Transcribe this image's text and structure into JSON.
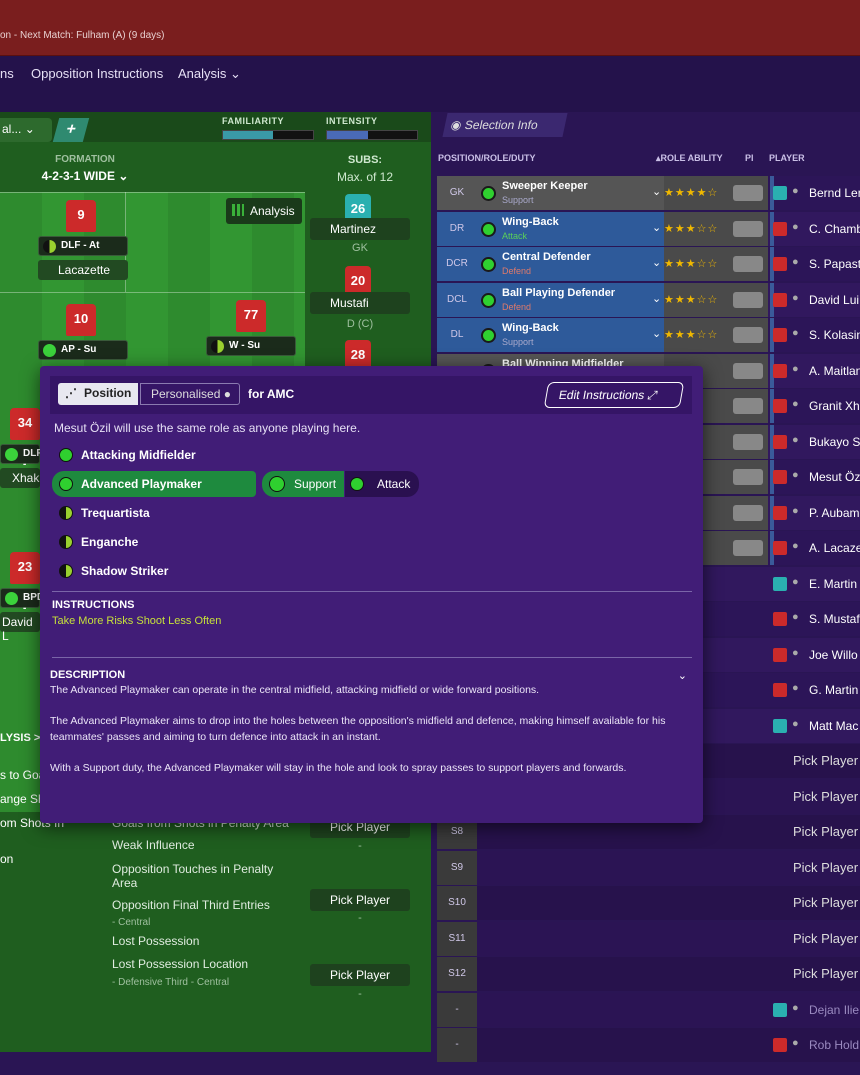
{
  "topbar": {
    "subtitle": "on - Next Match: Fulham (A) (9 days)"
  },
  "nav": {
    "items": [
      "ns",
      "Opposition Instructions",
      "Analysis ⌄"
    ]
  },
  "tactics": {
    "dropdown": "al...",
    "familiarity": "FAMILIARITY",
    "intensity": "INTENSITY",
    "familiarity_level": 0.55,
    "intensity_level": 0.45,
    "formation_label": "FORMATION",
    "formation": "4-2-3-1 WIDE",
    "subs_label": "SUBS:",
    "subs_max": "Max. of 12",
    "analysis_btn": "Analysis",
    "players": [
      {
        "num": "9",
        "role": "DLF - At",
        "name": "Lacazette"
      },
      {
        "num": "10",
        "role": "AP - Su"
      },
      {
        "num": "77",
        "role": "W - Su"
      },
      {
        "num": "34",
        "role": "DLP -",
        "name": "Xhak"
      },
      {
        "num": "23",
        "role": "BPD -",
        "name": "David L"
      }
    ],
    "subs": [
      {
        "num": "26",
        "name": "Martinez",
        "pos": "GK"
      },
      {
        "num": "20",
        "name": "Mustafi",
        "pos": "D (C)"
      },
      {
        "num": "28"
      },
      {
        "name": "Pick Player",
        "pos": "-"
      },
      {
        "name": "Pick Player",
        "pos": "-"
      },
      {
        "name": "Pick Player",
        "pos": "-"
      }
    ],
    "analysis_section": "LYSIS >",
    "stats_left": [
      "s to Goa",
      "ange Sho",
      "om Shots In",
      "on"
    ],
    "stats": [
      {
        "title": "Goals from Shots in Penalty Area",
        "sub": ""
      },
      {
        "title": "Weak Influence",
        "sub": ""
      },
      {
        "title": "Opposition Touches in Penalty Area",
        "sub": ""
      },
      {
        "title": "Opposition Final Third Entries",
        "sub": "- Central"
      },
      {
        "title": "Lost Possession",
        "sub": ""
      },
      {
        "title": "Lost Possession Location",
        "sub": "- Defensive Third - Central"
      }
    ]
  },
  "selection": {
    "info_btn": "Selection Info",
    "col_headers": [
      "POSITION/ROLE/DUTY",
      "▴ROLE ABILITY",
      "PI",
      "PLAYER"
    ],
    "rows": [
      {
        "pos": "GK",
        "role": "Sweeper Keeper",
        "duty": "Support",
        "stars": "★★★★☆",
        "player": "Bernd Len"
      },
      {
        "pos": "DR",
        "role": "Wing-Back",
        "duty": "Attack",
        "stars": "★★★☆☆",
        "player": "C. Chamb"
      },
      {
        "pos": "DCR",
        "role": "Central Defender",
        "duty": "Defend",
        "stars": "★★★☆☆",
        "player": "S. Papastathop"
      },
      {
        "pos": "DCL",
        "role": "Ball Playing Defender",
        "duty": "Defend",
        "stars": "★★★☆☆",
        "player": "David Lui"
      },
      {
        "pos": "DL",
        "role": "Wing-Back",
        "duty": "Support",
        "stars": "★★★☆☆",
        "player": "S. Kolasin"
      },
      {
        "pos": "",
        "role": "Ball Winning Midfielder",
        "duty": "",
        "stars": "",
        "player": "A. Maitland"
      },
      {
        "pos": "",
        "role": "",
        "duty": "",
        "stars": "",
        "player": "Granit Xh"
      },
      {
        "pos": "",
        "role": "",
        "duty": "",
        "stars": "",
        "player": "Bukayo S"
      },
      {
        "pos": "",
        "role": "",
        "duty": "",
        "stars": "★",
        "player": "Mesut Öz"
      },
      {
        "pos": "",
        "role": "",
        "duty": "",
        "stars": "",
        "player": "P. Aubamey"
      },
      {
        "pos": "",
        "role": "",
        "duty": "",
        "stars": "★",
        "player": "A. Lacaze"
      },
      {
        "pos": "",
        "role": "",
        "duty": "",
        "stars": "",
        "player": "E. Martin"
      },
      {
        "pos": "",
        "role": "",
        "duty": "",
        "stars": "",
        "player": "S. Mustaf"
      },
      {
        "pos": "",
        "role": "",
        "duty": "",
        "stars": "",
        "player": "Joe Willo"
      },
      {
        "pos": "",
        "role": "",
        "duty": "",
        "stars": "",
        "player": "G. Martin"
      },
      {
        "pos": "",
        "role": "",
        "duty": "",
        "stars": "",
        "player": "Matt Mac"
      },
      {
        "pos": "",
        "player": "Pick Player"
      },
      {
        "pos": "",
        "player": "Pick Player"
      },
      {
        "pos": "S8",
        "player": "Pick Player"
      },
      {
        "pos": "S9",
        "player": "Pick Player"
      },
      {
        "pos": "S10",
        "player": "Pick Player"
      },
      {
        "pos": "S11",
        "player": "Pick Player"
      },
      {
        "pos": "S12",
        "player": "Pick Player"
      },
      {
        "pos": "-",
        "player": "Dejan Ilie"
      },
      {
        "pos": "-",
        "player": "Rob Hold"
      }
    ]
  },
  "overlay": {
    "tab_position": "Position",
    "tab_personalised": "Personalised",
    "for_label": "for AMC",
    "edit_btn": "Edit Instructions",
    "note": "Mesut Özil will use the same role as anyone playing here.",
    "roles": [
      "Attacking Midfielder",
      "Advanced Playmaker",
      "Trequartista",
      "Enganche",
      "Shadow Striker"
    ],
    "duties": [
      "Support",
      "Attack"
    ],
    "instructions_title": "INSTRUCTIONS",
    "instructions": "Take More Risks   Shoot Less Often",
    "description_title": "DESCRIPTION",
    "desc1": "The Advanced Playmaker can operate in the central midfield, attacking midfield or wide forward positions.",
    "desc2": "The Advanced Playmaker aims to drop into the holes between the opposition's midfield and defence, making himself available for his teammates' passes and aiming to turn defence into attack in an instant.",
    "desc3": "With a Support duty, the Advanced Playmaker will stay in the hole and look to spray passes to support players and forwards."
  }
}
